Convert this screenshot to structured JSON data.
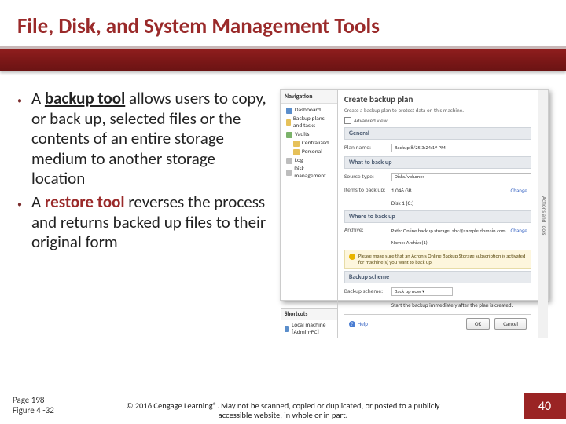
{
  "title": "File, Disk, and System Management Tools",
  "bullets": [
    {
      "pre": "A ",
      "term": "backup tool",
      "termClass": "term1",
      "post": " allows users to copy, or back up, selected files or the contents of an entire storage medium to another storage location"
    },
    {
      "pre": "A ",
      "term": "restore tool",
      "termClass": "term2",
      "post": " reverses the process and returns backed up files to their original form"
    }
  ],
  "figure": {
    "navHeader": "Navigation",
    "tree": [
      {
        "cls": "blue",
        "label": "Dashboard"
      },
      {
        "cls": "yel",
        "label": "Backup plans and tasks"
      },
      {
        "cls": "grn",
        "label": "Vaults"
      },
      {
        "cls": "folder",
        "label": "Centralized"
      },
      {
        "cls": "folder",
        "label": "Personal"
      },
      {
        "cls": "gry",
        "label": "Log"
      },
      {
        "cls": "gry",
        "label": "Disk management"
      }
    ],
    "shortcutsHeader": "Shortcuts",
    "shortcut": "Local machine [Admin-PC]",
    "contentTitle": "Create backup plan",
    "contentSub": "Create a backup plan to protect data on this machine.",
    "advanced": "Advanced view",
    "sections": {
      "general": "General",
      "what": "What to back up",
      "where": "Where to back up",
      "scheme": "Backup scheme"
    },
    "rows": {
      "planName": {
        "lbl": "Plan name:",
        "val": "Backup 8/25 3:24:19 PM"
      },
      "sourceType": {
        "lbl": "Source type:",
        "val": "Disks/volumes"
      },
      "items": {
        "lbl": "Items to back up:",
        "val": "1,046 GB",
        "link": "Change..."
      },
      "items2": {
        "val": "Disk 1 (C:)"
      },
      "archive": {
        "lbl": "Archive:",
        "val": "Path: Online backup storage, abc@sample.domain.com",
        "link": "Change..."
      },
      "archive2": {
        "val": "Name: Archive(1)"
      },
      "scheme": {
        "lbl": "Backup scheme:",
        "val": "Back up now ▾"
      },
      "scheme2": {
        "val": "Start the backup immediately after the plan is created."
      }
    },
    "note": "Please make sure that an Acronis Online Backup Storage subscription is activated for machine(s) you want to back up.",
    "help": "Help",
    "ok": "OK",
    "cancel": "Cancel",
    "rail": "Actions and Tools"
  },
  "pageRef1": "Page 198",
  "pageRef2": "Figure 4 -32",
  "copyright": "© 2016 Cengage Learning®. May not be scanned, copied or duplicated, or posted to a publicly accessible website, in whole or in part.",
  "pageNum": "40"
}
